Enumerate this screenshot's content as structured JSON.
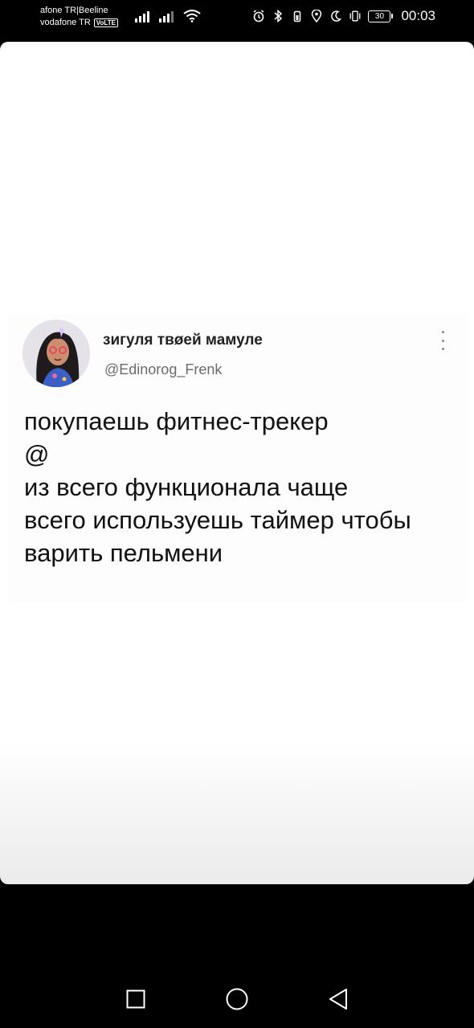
{
  "status_bar": {
    "carrier_line1": "afone TR|Beeline",
    "carrier_line2": "vodafone TR",
    "volte_badge": "VoLTE",
    "battery_level": "30",
    "time": "00:03",
    "icons": [
      "signal-icon",
      "signal-icon",
      "wifi-icon",
      "alarm-icon",
      "bluetooth-icon",
      "location-icon",
      "do-not-disturb-icon",
      "vibrate-icon",
      "battery-icon"
    ]
  },
  "tweet": {
    "display_name": "зигуля твøей мамуле",
    "handle": "@Edinorog_Frenk",
    "body_lines": [
      "покупаешь фитнес-трекер",
      "@",
      "из всего функционала чаще",
      "всего используешь таймер чтобы",
      "варить пельмени"
    ]
  },
  "nav_bar": {
    "buttons": [
      "recents-button",
      "home-button",
      "back-button"
    ]
  },
  "colors": {
    "background": "#000000",
    "card": "#ffffff",
    "text": "#111111",
    "handle": "#6b6b6b"
  }
}
